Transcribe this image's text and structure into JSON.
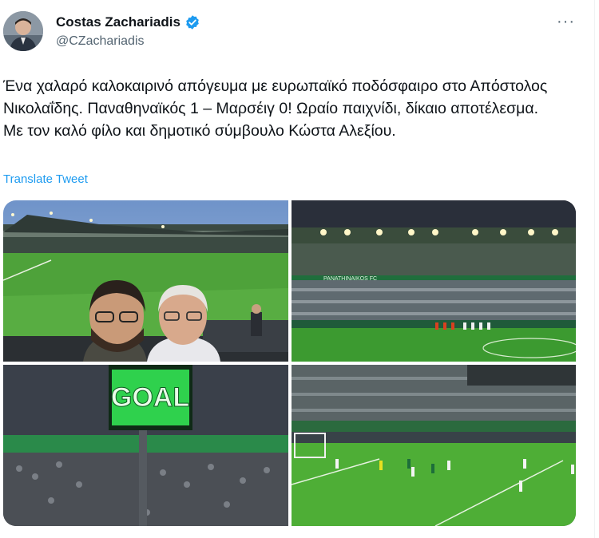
{
  "author": {
    "name": "Costas Zachariadis",
    "handle": "@CZachariadis",
    "verified_icon": "verified-badge-icon",
    "verified_color": "#1d9bf0"
  },
  "tweet": {
    "text": "Ένα χαλαρό καλοκαιρινό απόγευμα με ευρωπαϊκό ποδόσφαιρο στο Απόστολος Νικολαΐδης. Παναθηναϊκός 1 – Μαρσέιγ 0! Ωραίο παιχνίδι, δίκαιο αποτέλεσμα. Με τον καλό φίλο και δημοτικό σύμβουλο Κώστα Αλεξίου.",
    "translate_label": "Translate Tweet",
    "more_label": "···"
  },
  "photos": {
    "sign_text": "GOAL",
    "banner_text": "PANATHINAIKOS FC"
  },
  "colors": {
    "link": "#1d9bf0",
    "pitch": "#3f9c2f",
    "stadium_green": "#1f6e3c"
  }
}
